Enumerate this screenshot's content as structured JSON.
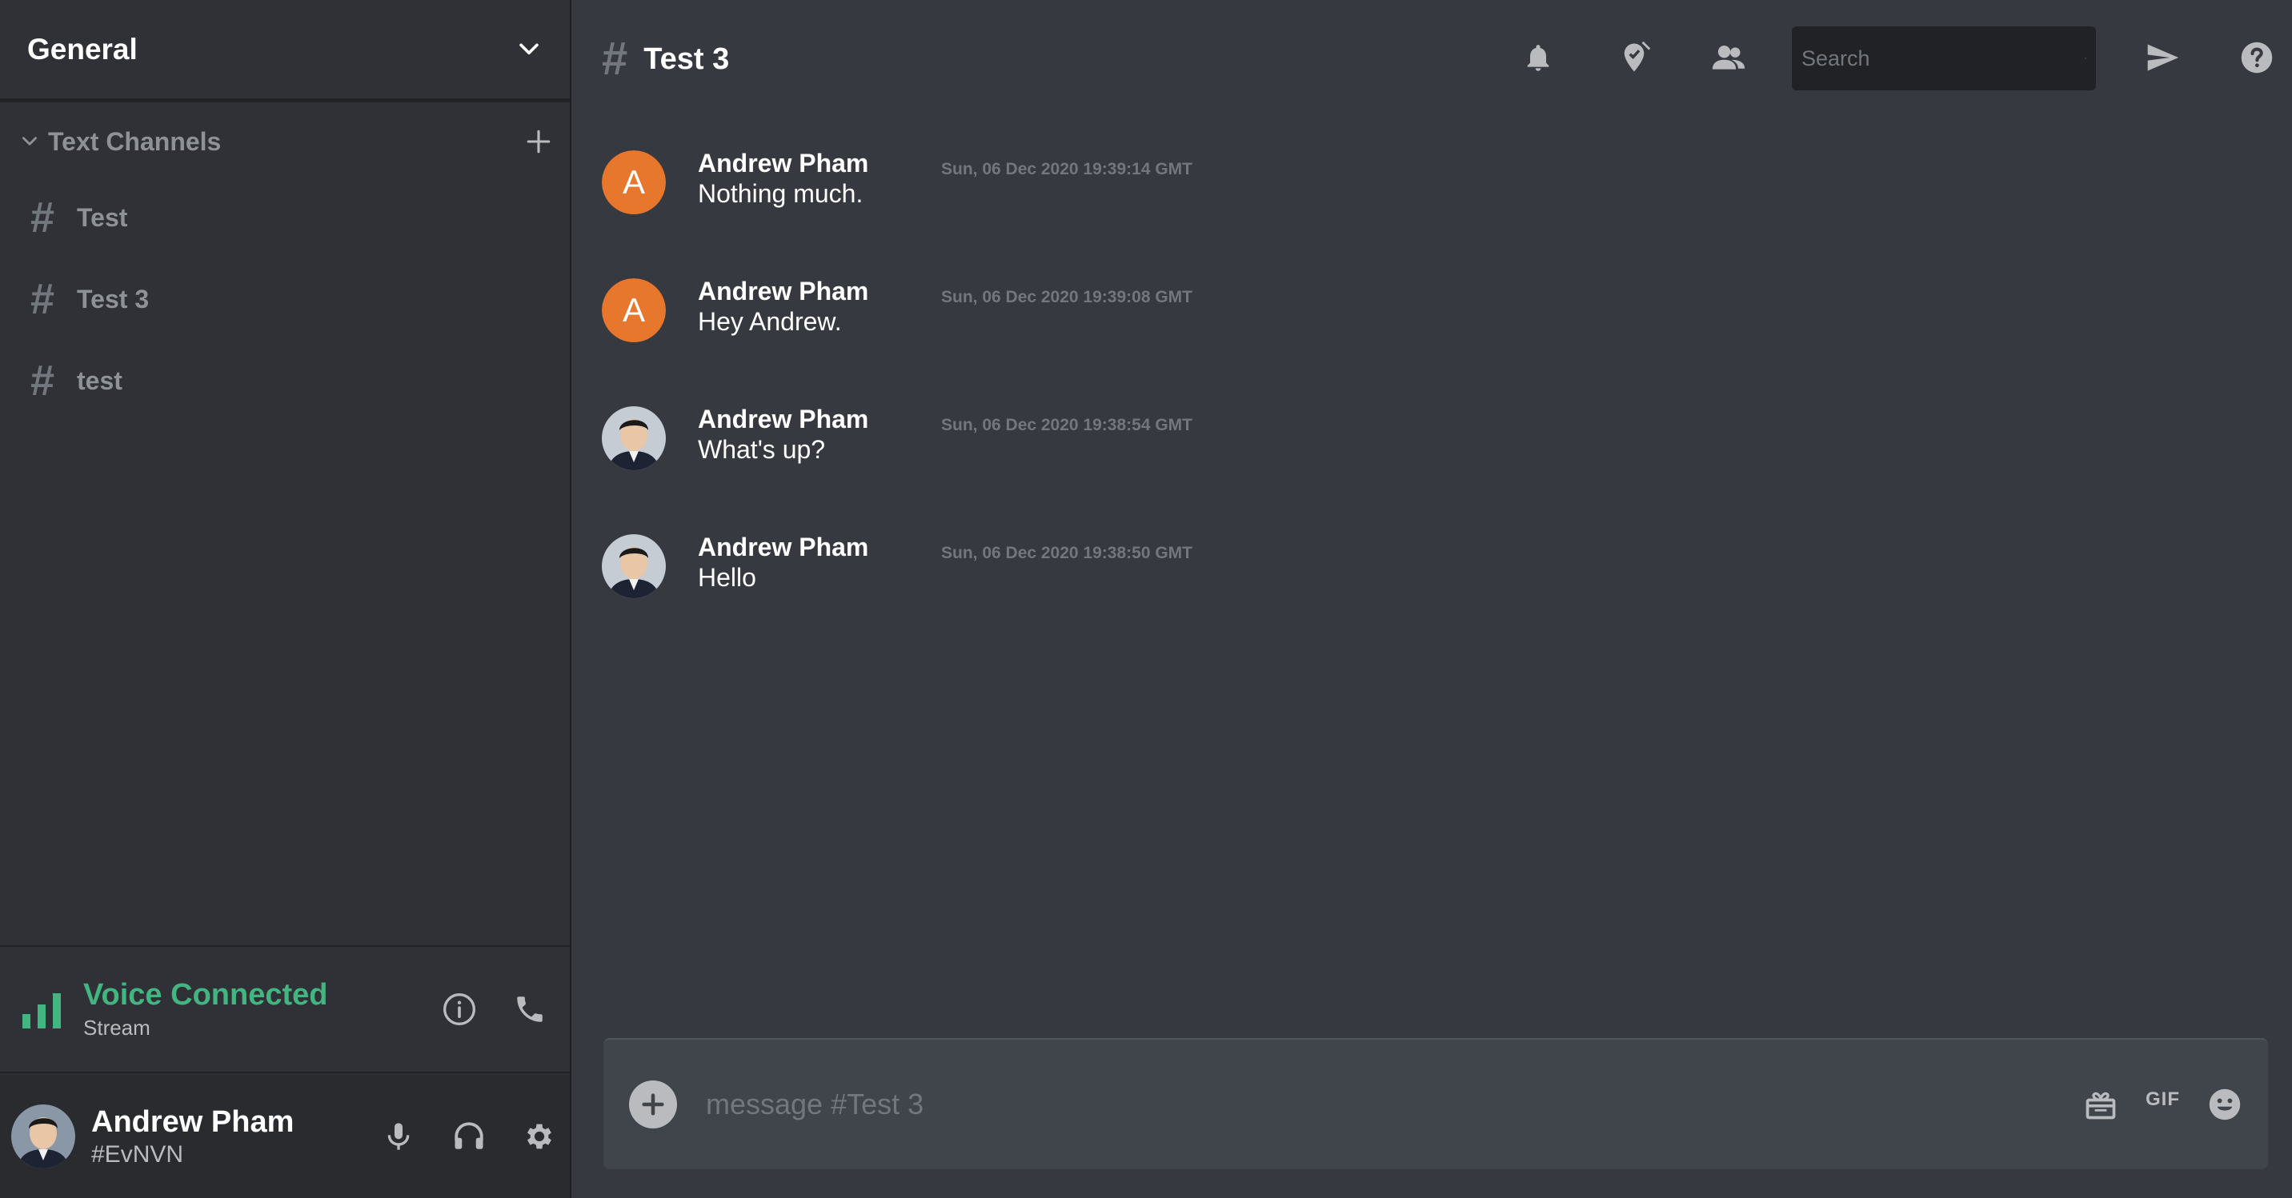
{
  "server": {
    "name": "General"
  },
  "category": {
    "label": "Text Channels"
  },
  "channels": [
    {
      "hash": "#",
      "name": "Test"
    },
    {
      "hash": "#",
      "name": "Test 3"
    },
    {
      "hash": "#",
      "name": "test"
    }
  ],
  "voice": {
    "status": "Voice Connected",
    "channel": "Stream",
    "color": "#43b581"
  },
  "user": {
    "name": "Andrew Pham",
    "tag": "#EvNVN"
  },
  "header": {
    "hash": "#",
    "channel": "Test 3"
  },
  "search": {
    "placeholder": "Search"
  },
  "messages": [
    {
      "avatar_letter": "A",
      "avatar_color": "#e8772e",
      "author": "Andrew Pham",
      "timestamp": "Sun, 06 Dec 2020 19:39:14 GMT",
      "text": "Nothing much."
    },
    {
      "avatar_letter": "A",
      "avatar_color": "#e8772e",
      "author": "Andrew Pham",
      "timestamp": "Sun, 06 Dec 2020 19:39:08 GMT",
      "text": "Hey Andrew."
    },
    {
      "avatar": "photo",
      "author": "Andrew Pham",
      "timestamp": "Sun, 06 Dec 2020 19:38:54 GMT",
      "text": "What's up?"
    },
    {
      "avatar": "photo",
      "author": "Andrew Pham",
      "timestamp": "Sun, 06 Dec 2020 19:38:50 GMT",
      "text": "Hello"
    }
  ],
  "composer": {
    "placeholder": "message #Test 3",
    "gif_label": "GIF"
  },
  "icons": {
    "server_menu": "chevron-down-icon",
    "category_collapse": "chevron-down-icon",
    "add_channel": "plus-icon",
    "voice_signal": "signal-bars-icon",
    "voice_info": "info-icon",
    "voice_disconnect": "phone-icon",
    "mic": "microphone-icon",
    "headset": "headphones-icon",
    "settings": "gear-icon",
    "notifications": "bell-icon",
    "pins": "pin-icon",
    "members": "members-icon",
    "search": "search-icon",
    "inbox": "send-icon",
    "help": "help-icon",
    "attach": "plus-circle-icon",
    "gift": "gift-icon",
    "emoji": "emoji-icon"
  },
  "colors": {
    "sidebar_bg": "#2f3136",
    "main_bg": "#36393f",
    "user_panel_bg": "#292b2f",
    "accent_green": "#43b581",
    "avatar_orange": "#e8772e"
  }
}
